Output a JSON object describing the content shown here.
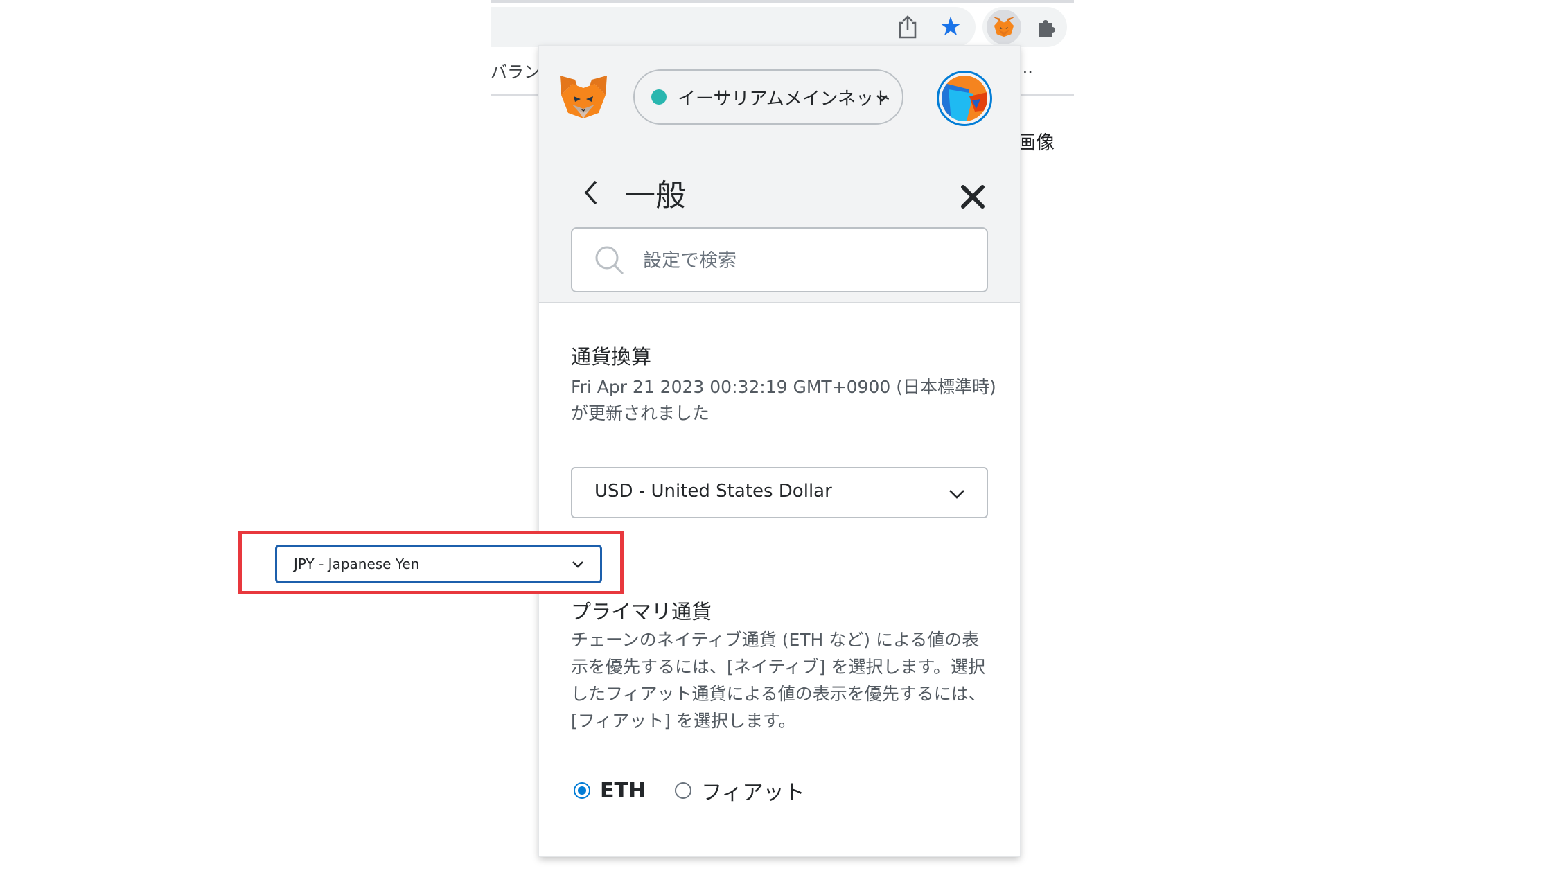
{
  "browser": {
    "bookmark_fragment_left": "バラン",
    "bookmark_fragment_right": "...",
    "page_fragment_right": "画像",
    "icons": [
      "share-icon",
      "bookmark-star-icon",
      "metamask-extension-icon",
      "extensions-puzzle-icon"
    ]
  },
  "metamask": {
    "network": {
      "label": "イーサリアムメインネット",
      "dot_color": "#29b6af"
    },
    "header": {
      "title": "一般"
    },
    "search": {
      "placeholder": "設定で検索"
    },
    "currency_conversion": {
      "title": "通貨換算",
      "updated_text": "Fri Apr 21 2023 00:32:19 GMT+0900 (日本標準時) が更新されました",
      "selected": "USD - United States Dollar"
    },
    "primary_currency": {
      "title": "プライマリ通貨",
      "description": "チェーンのネイティブ通貨 (ETH など) による値の表示を優先するには、[ネイティブ] を選択します。選択したフィアット通貨による値の表示を優先するには、[フィアット] を選択します。",
      "options": [
        {
          "label": "ETH",
          "selected": true
        },
        {
          "label": "フィアット",
          "selected": false
        }
      ]
    }
  },
  "callout": {
    "selected": "JPY - Japanese Yen",
    "border_color": "#e8383d"
  },
  "colors": {
    "accent": "#037dd6",
    "callout": "#e8383d",
    "star": "#1a73e8"
  }
}
